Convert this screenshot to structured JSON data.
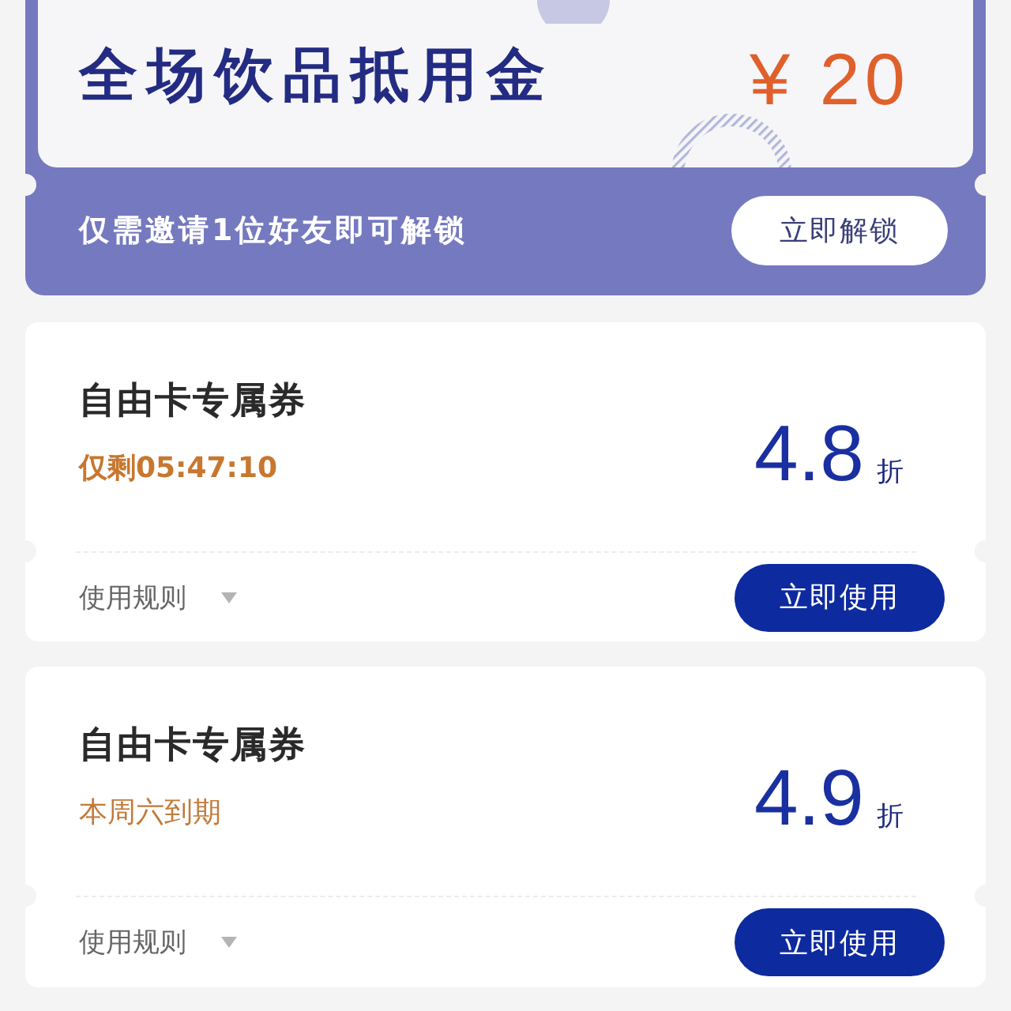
{
  "promo": {
    "title": "全场饮品抵用金",
    "amount": "¥ 20",
    "invite_text": "仅需邀请**1位**好友即可解锁",
    "button": "立即解锁"
  },
  "coupons": [
    {
      "title": "自由卡专属券",
      "kind": "countdown",
      "validity": "仅剩05:47:10",
      "discount": "4.8",
      "unit": "折",
      "rules": {
        "label": "使用规则",
        "expanded": false
      },
      "button": "立即使用"
    },
    {
      "title": "自由卡专属券",
      "kind": "expiry",
      "validity": "本周六到期",
      "discount": "4.9",
      "unit": "折",
      "rules": {
        "label": "使用规则",
        "expanded": false
      },
      "button": "立即使用"
    }
  ]
}
